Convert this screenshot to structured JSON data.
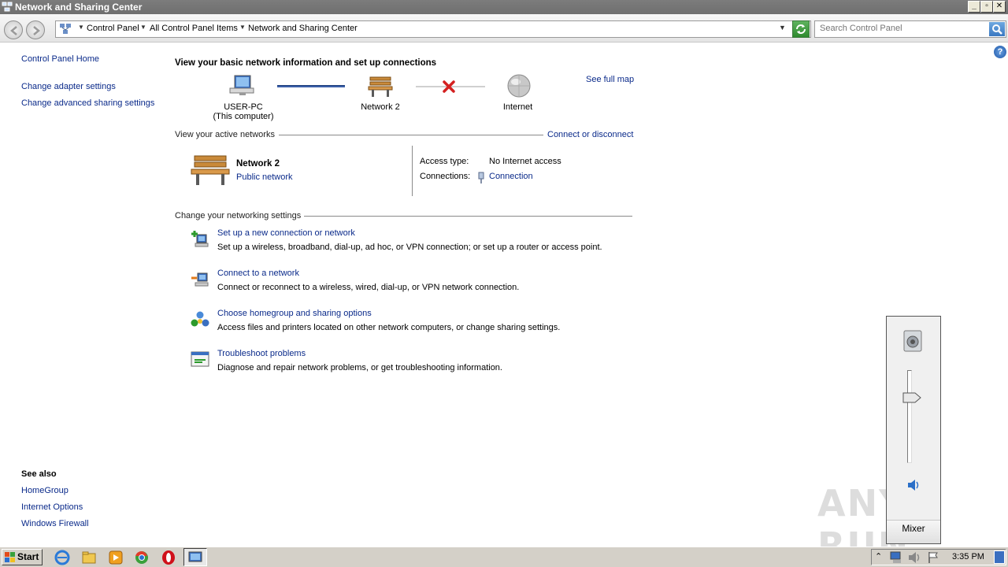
{
  "window": {
    "title": "Network and Sharing Center"
  },
  "address": {
    "crumbs": [
      "Control Panel",
      "All Control Panel Items",
      "Network and Sharing Center"
    ],
    "search_placeholder": "Search Control Panel"
  },
  "left_pane": {
    "home": "Control Panel Home",
    "links": [
      "Change adapter settings",
      "Change advanced sharing settings"
    ],
    "see_also_title": "See also",
    "see_also": [
      "HomeGroup",
      "Internet Options",
      "Windows Firewall"
    ]
  },
  "main": {
    "heading": "View your basic network information and set up connections",
    "map": {
      "computer_name": "USER-PC",
      "computer_sub": "(This computer)",
      "network": "Network  2",
      "internet": "Internet",
      "see_full_map": "See full map"
    },
    "active": {
      "title": "View your active networks",
      "connect_link": "Connect or disconnect",
      "network_name": "Network  2",
      "network_type": "Public network",
      "access_label": "Access type:",
      "access_value": "No Internet access",
      "connections_label": "Connections:",
      "connections_value": "Connection"
    },
    "settings": {
      "title": "Change your networking settings",
      "tasks": [
        {
          "link": "Set up a new connection or network",
          "desc": "Set up a wireless, broadband, dial-up, ad hoc, or VPN connection; or set up a router or access point."
        },
        {
          "link": "Connect to a network",
          "desc": "Connect or reconnect to a wireless, wired, dial-up, or VPN network connection."
        },
        {
          "link": "Choose homegroup and sharing options",
          "desc": "Access files and printers located on other network computers, or change sharing settings."
        },
        {
          "link": "Troubleshoot problems",
          "desc": "Diagnose and repair network problems, or get troubleshooting information."
        }
      ]
    }
  },
  "volume": {
    "mixer": "Mixer",
    "level": 0.7
  },
  "watermark": "ANY RUN",
  "taskbar": {
    "start": "Start",
    "clock": "3:35 PM"
  }
}
